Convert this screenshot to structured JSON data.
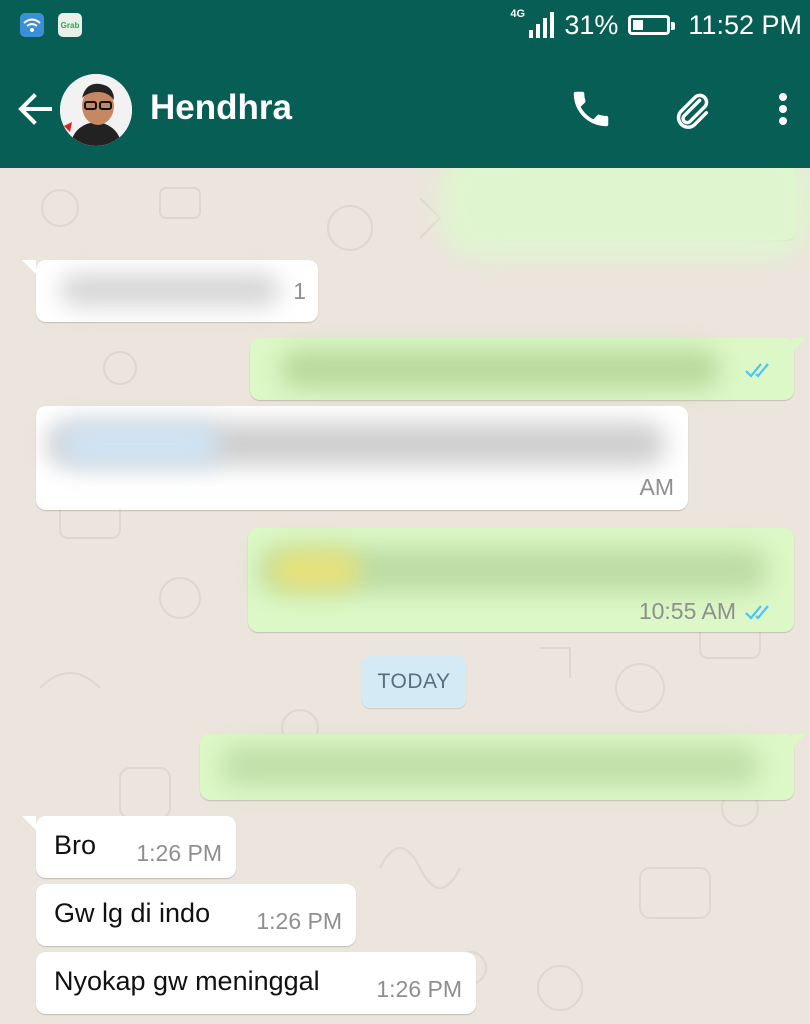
{
  "status_bar": {
    "network": "4G",
    "battery": "31%",
    "battery_level": 0.31,
    "time": "11:52 PM",
    "notification_icons": [
      "wifi-icon",
      "grab-icon"
    ],
    "grab_label": "Grab"
  },
  "header": {
    "contact_name": "Hendhra",
    "icons": [
      "back-arrow-icon",
      "phone-icon",
      "paperclip-icon",
      "more-vert-icon"
    ]
  },
  "colors": {
    "header": "#075E54",
    "chat_background": "#ECE5DD",
    "outgoing_bubble": "#DCF8C6",
    "incoming_bubble": "#FFFFFF",
    "read_ticks": "#4FC3F7",
    "date_chip": "#D4EAF4"
  },
  "messages_before_today": [
    {
      "direction": "outgoing",
      "text": "",
      "time": "",
      "redacted": true
    },
    {
      "direction": "incoming",
      "text": "",
      "time": "1",
      "redacted": true
    },
    {
      "direction": "outgoing",
      "text": "",
      "time": "",
      "status": "read",
      "redacted": true
    },
    {
      "direction": "incoming",
      "text": "",
      "time": "AM",
      "redacted": true
    },
    {
      "direction": "outgoing",
      "text": "",
      "time": "10:55 AM",
      "status": "read",
      "redacted": true
    }
  ],
  "date_separator": "TODAY",
  "messages_today": [
    {
      "direction": "outgoing",
      "text": "",
      "redacted": true
    },
    {
      "direction": "incoming",
      "text": "Bro",
      "time": "1:26 PM"
    },
    {
      "direction": "incoming",
      "text": "Gw lg di indo",
      "time": "1:26 PM"
    },
    {
      "direction": "incoming",
      "text": "Nyokap gw meninggal",
      "time": "1:26 PM"
    }
  ]
}
